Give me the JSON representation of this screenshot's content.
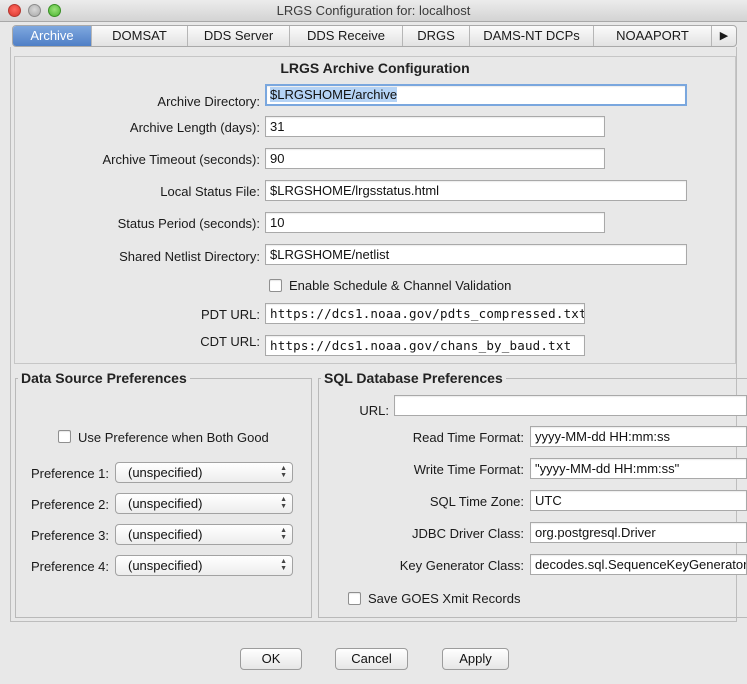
{
  "window": {
    "title": "LRGS Configuration for:  localhost"
  },
  "tabs": [
    "Archive",
    "DOMSAT",
    "DDS Server",
    "DDS Receive",
    "DRGS",
    "DAMS-NT DCPs",
    "NOAAPORT"
  ],
  "tab_overflow_arrow": "▶",
  "archive": {
    "heading": "LRGS Archive Configuration",
    "archive_directory_label": "Archive Directory:",
    "archive_directory_value": "$LRGSHOME/archive",
    "archive_length_label": "Archive Length (days):",
    "archive_length_value": "31",
    "archive_timeout_label": "Archive Timeout (seconds):",
    "archive_timeout_value": "90",
    "local_status_file_label": "Local Status File:",
    "local_status_file_value": "$LRGSHOME/lrgsstatus.html",
    "status_period_label": "Status Period (seconds):",
    "status_period_value": "10",
    "shared_netlist_label": "Shared Netlist Directory:",
    "shared_netlist_value": "$LRGSHOME/netlist",
    "enable_validation_label": "Enable Schedule & Channel Validation",
    "pdt_url_label": "PDT URL:",
    "pdt_url_value": "https://dcs1.noaa.gov/pdts_compressed.txt",
    "cdt_url_label": "CDT URL:",
    "cdt_url_value": "https://dcs1.noaa.gov/chans_by_baud.txt"
  },
  "data_source": {
    "heading": "Data Source Preferences",
    "use_pref_label": "Use Preference when Both Good",
    "preferences": [
      {
        "label": "Preference 1:",
        "value": "(unspecified)"
      },
      {
        "label": "Preference 2:",
        "value": "(unspecified)"
      },
      {
        "label": "Preference 3:",
        "value": "(unspecified)"
      },
      {
        "label": "Preference 4:",
        "value": "(unspecified)"
      }
    ]
  },
  "sql": {
    "heading": "SQL Database Preferences",
    "url_label": "URL:",
    "url_value": "",
    "read_time_label": "Read Time Format:",
    "read_time_value": "yyyy-MM-dd HH:mm:ss",
    "write_time_label": "Write Time Format:",
    "write_time_value": "\"yyyy-MM-dd HH:mm:ss\"",
    "time_zone_label": "SQL Time Zone:",
    "time_zone_value": "UTC",
    "jdbc_driver_label": "JDBC Driver Class:",
    "jdbc_driver_value": "org.postgresql.Driver",
    "key_gen_label": "Key Generator Class:",
    "key_gen_value": "decodes.sql.SequenceKeyGenerator",
    "save_goes_label": "Save GOES Xmit Records"
  },
  "buttons": {
    "ok": "OK",
    "cancel": "Cancel",
    "apply": "Apply"
  },
  "colors": {
    "active_tab": "#4f7fc6",
    "focus_ring": "#7aa7de",
    "selection": "#b5d3f5"
  }
}
